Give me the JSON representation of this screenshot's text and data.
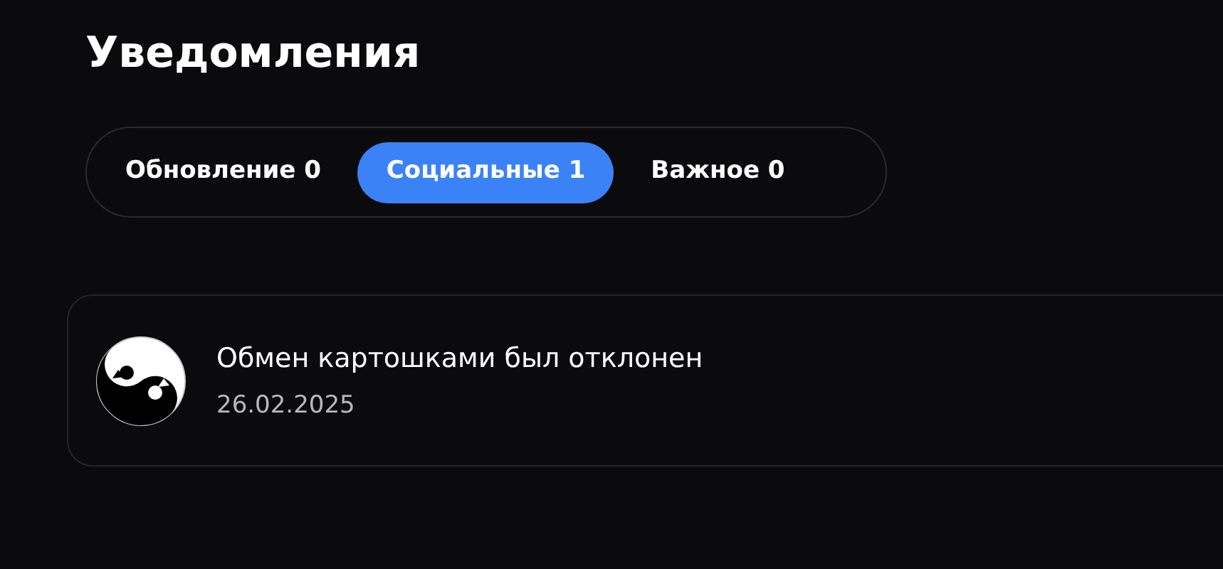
{
  "title": "Уведомления",
  "tabs": [
    {
      "label": "Обновление 0",
      "selected": false
    },
    {
      "label": "Социальные 1",
      "selected": true
    },
    {
      "label": "Важное 0",
      "selected": false
    }
  ],
  "notifications": [
    {
      "text": "Обмен картошками был отклонен",
      "date": "26.02.2025"
    }
  ]
}
